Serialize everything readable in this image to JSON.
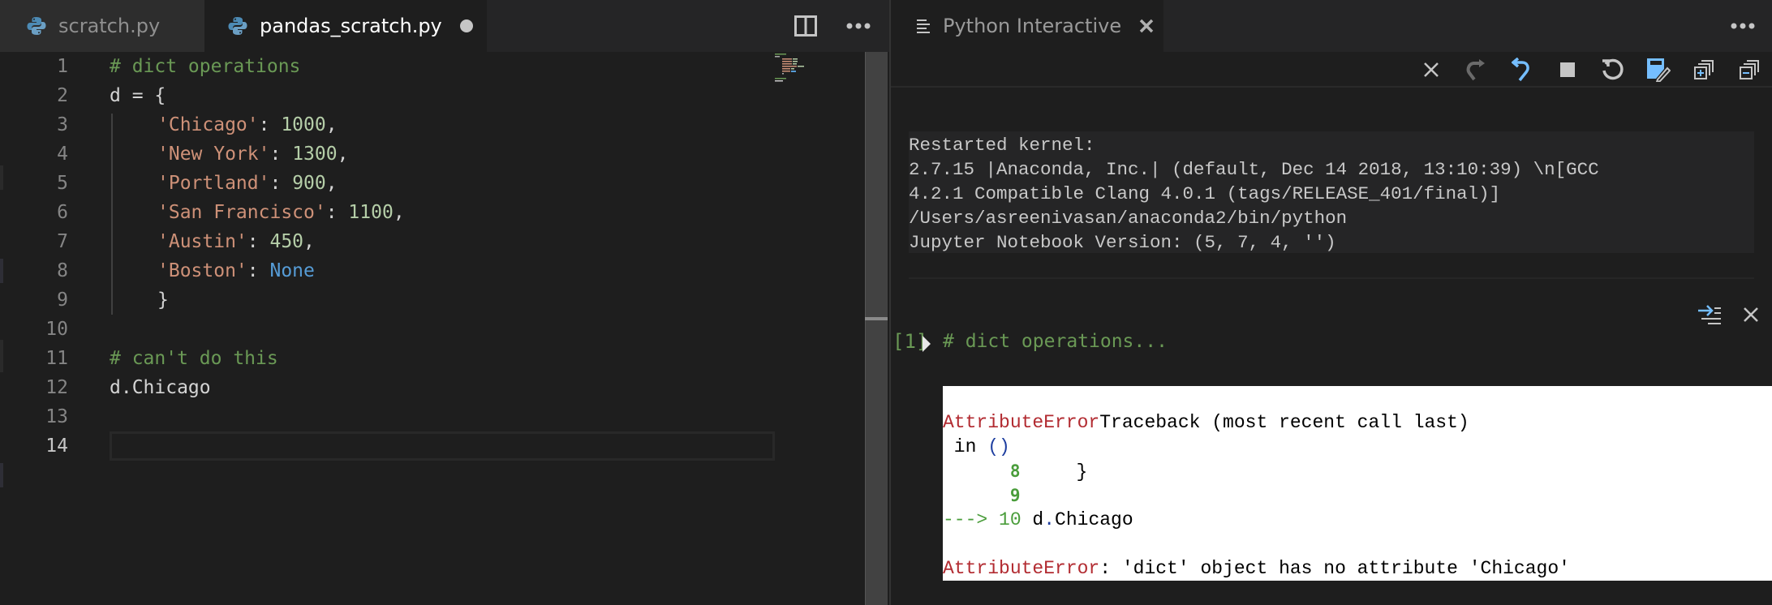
{
  "left_editor": {
    "tabs": [
      {
        "label": "scratch.py",
        "icon": "python-icon",
        "active": false
      },
      {
        "label": "pandas_scratch.py",
        "icon": "python-icon",
        "active": true,
        "unsaved": true
      }
    ],
    "actions": {
      "split": "split-editor-icon",
      "more": "more-icon"
    },
    "line_numbers": [
      "1",
      "2",
      "3",
      "4",
      "5",
      "6",
      "7",
      "8",
      "9",
      "10",
      "11",
      "12",
      "13",
      "14"
    ],
    "active_line": 14,
    "code": {
      "l1": "# dict operations",
      "l2": "d = {",
      "l3_key": "'Chicago'",
      "l3_sep": ": ",
      "l3_val": "1000",
      "l3_end": ",",
      "l4_key": "'New York'",
      "l4_sep": ": ",
      "l4_val": "1300",
      "l4_end": ",",
      "l5_key": "'Portland'",
      "l5_sep": ": ",
      "l5_val": "900",
      "l5_end": ",",
      "l6_key": "'San Francisco'",
      "l6_sep": ": ",
      "l6_val": "1100",
      "l6_end": ",",
      "l7_key": "'Austin'",
      "l7_sep": ": ",
      "l7_val": "450",
      "l7_end": ",",
      "l8_key": "'Boston'",
      "l8_sep": ": ",
      "l8_val": "None",
      "l9": "}",
      "l11": "# can't do this",
      "l12": "d.Chicago"
    }
  },
  "interactive": {
    "tab": {
      "label": "Python Interactive",
      "icon": "lines-icon"
    },
    "toolbar": [
      "clear-all",
      "redo",
      "undo",
      "interrupt-kernel",
      "restart-kernel",
      "save-as-notebook",
      "expand-all",
      "collapse-all"
    ],
    "sysinfo": [
      "Restarted kernel:",
      "2.7.15 |Anaconda, Inc.| (default, Dec 14 2018, 13:10:39) \\n[GCC",
      "4.2.1 Compatible Clang 4.0.1 (tags/RELEASE_401/final)]",
      "/Users/asreenivasan/anaconda2/bin/python",
      "Jupyter Notebook Version: (5, 7, 4, '')"
    ],
    "cell": {
      "prompt": "[1]",
      "code": "# dict operations..."
    },
    "output": {
      "l1_err": "AttributeError",
      "l1_rest": "Traceback (most recent call last)",
      "l2_in": " in ",
      "l2_paren": "()",
      "l3_num": "8",
      "l3_code": "     }",
      "l4_num": "9",
      "l5_arrow": "---> 10",
      "l5_code": " d",
      "l5_dot": ".",
      "l5_attr": "Chicago",
      "l7_err": "AttributeError",
      "l7_msg": ": 'dict' object has no attribute 'Chicago'"
    }
  },
  "colors": {
    "accent_blue": "#75beff",
    "comment": "#6a9955",
    "string": "#ce9178",
    "number": "#b5cea8",
    "keyword_const": "#569cd6",
    "error_red": "#b22b31"
  }
}
